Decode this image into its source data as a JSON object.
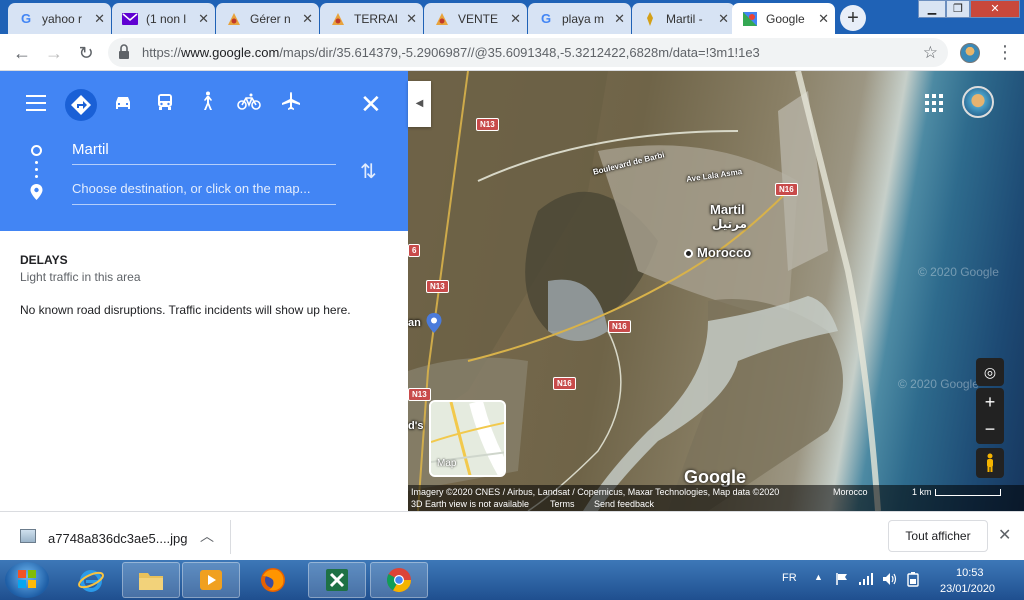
{
  "browser": {
    "tabs": [
      {
        "title": "yahoo r",
        "icon": "google-g-icon",
        "active": false
      },
      {
        "title": "(1 non l",
        "icon": "yahoo-mail-icon",
        "active": false
      },
      {
        "title": "Gérer n",
        "icon": "site-favicon",
        "active": false
      },
      {
        "title": "TERRAI",
        "icon": "site-favicon",
        "active": false
      },
      {
        "title": "VENTE",
        "icon": "site-favicon",
        "active": false
      },
      {
        "title": "playa m",
        "icon": "google-g-icon",
        "active": false
      },
      {
        "title": "Martil -",
        "icon": "site-favicon",
        "active": false
      },
      {
        "title": "Google",
        "icon": "google-maps-icon",
        "active": true
      }
    ],
    "url_prefix": "https://",
    "url_domain": "www.google.com",
    "url_path": "/maps/dir/35.614379,-5.2906987//@35.6091348,-5.3212422,6828m/data=!3m1!1e3"
  },
  "directions": {
    "origin_value": "Martil",
    "destination_placeholder": "Choose destination, or click on the map...",
    "delays_title": "DELAYS",
    "delays_subtitle": "Light traffic in this area",
    "disruptions_text": "No known road disruptions. Traffic incidents will show up here."
  },
  "map": {
    "roads": {
      "n13_a": "N13",
      "n13_b": "N13",
      "n13_c": "N13",
      "n16_a": "N16",
      "n16_b": "N16",
      "n16_c": "N16",
      "r6": "6"
    },
    "street_labels": {
      "boulevard": "Boulevard de Barbi",
      "avenue": "Ave Lala Asma"
    },
    "places": {
      "martil_latin": "Martil",
      "martil_arabic": "مرتيل",
      "morocco": "Morocco",
      "left_edge_an": "an",
      "left_edge_ds": "d's"
    },
    "watermark": "© 2020 Google",
    "minimap_label": "Map",
    "google_logo": "Google",
    "attribution": "Imagery ©2020 CNES / Airbus, Landsat / Copernicus, Maxar Technologies, Map data ©2020",
    "attribution_country": "Morocco",
    "scale_label": "1 km",
    "earth_view_note": "3D Earth view is not available",
    "terms": "Terms",
    "feedback": "Send feedback"
  },
  "download": {
    "filename": "a7748a836dc3ae5....jpg",
    "show_all": "Tout afficher"
  },
  "taskbar": {
    "language": "FR",
    "time": "10:53",
    "date": "23/01/2020"
  }
}
